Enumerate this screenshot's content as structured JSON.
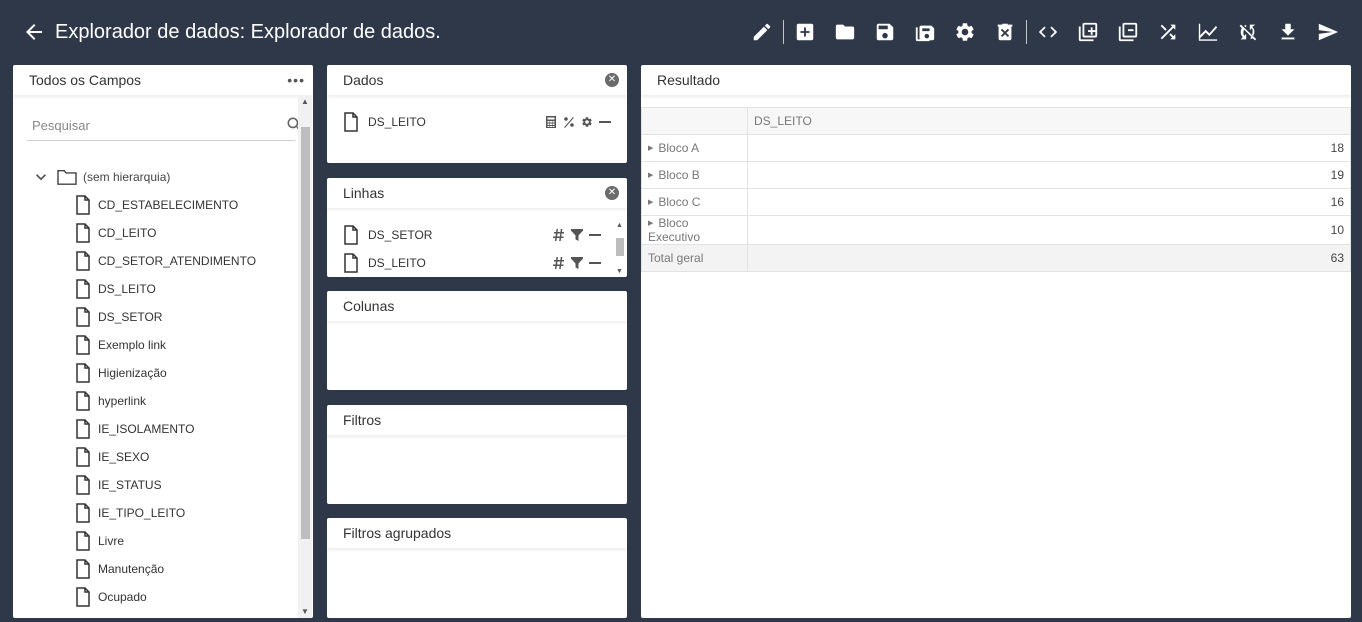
{
  "header": {
    "title": "Explorador de dados: Explorador de dados.",
    "toolbar_icons": [
      "edit-icon",
      "add-box-icon",
      "folder-icon",
      "save-icon",
      "save-as-icon",
      "settings-icon",
      "delete-icon",
      "code-icon",
      "copy-add-icon",
      "copy-remove-icon",
      "shuffle-icon",
      "chart-icon",
      "sync-disabled-icon",
      "download-icon",
      "send-icon"
    ]
  },
  "fields": {
    "title": "Todos os Campos",
    "search_placeholder": "Pesquisar",
    "root_label": "(sem hierarquia)",
    "items": [
      "CD_ESTABELECIMENTO",
      "CD_LEITO",
      "CD_SETOR_ATENDIMENTO",
      "DS_LEITO",
      "DS_SETOR",
      "Exemplo link",
      "Higienização",
      "hyperlink",
      "IE_ISOLAMENTO",
      "IE_SEXO",
      "IE_STATUS",
      "IE_TIPO_LEITO",
      "Livre",
      "Manutenção",
      "Ocupado"
    ]
  },
  "data_panel": {
    "title": "Dados",
    "items": [
      "DS_LEITO"
    ]
  },
  "rows_panel": {
    "title": "Linhas",
    "items": [
      "DS_SETOR",
      "DS_LEITO"
    ]
  },
  "cols_panel": {
    "title": "Colunas"
  },
  "filters_panel": {
    "title": "Filtros"
  },
  "grouped_panel": {
    "title": "Filtros agrupados"
  },
  "result": {
    "title": "Resultado",
    "column_header": "DS_LEITO",
    "rows": [
      {
        "label": "Bloco A",
        "value": "18"
      },
      {
        "label": "Bloco B",
        "value": "19"
      },
      {
        "label": "Bloco C",
        "value": "16"
      },
      {
        "label": "Bloco Executivo",
        "value": "10"
      }
    ],
    "total_label": "Total geral",
    "total_value": "63"
  }
}
